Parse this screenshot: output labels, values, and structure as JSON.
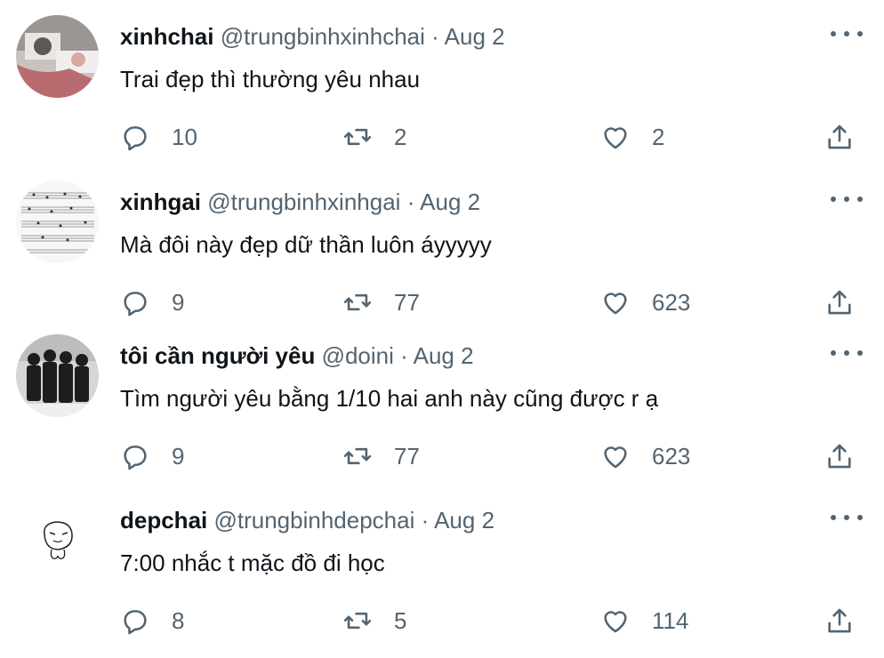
{
  "tweets": [
    {
      "name": "xinhchai",
      "handle": "@trungbinhxinhchai",
      "dot": "·",
      "date": "Aug 2",
      "text": "Trai đẹp thì thường yêu nhau",
      "replies": "10",
      "retweets": "2",
      "likes": "2",
      "avatar_icon": "photo-avatar"
    },
    {
      "name": "xinhgai",
      "handle": "@trungbinhxinhgai",
      "dot": "·",
      "date": "Aug 2",
      "text": "Mà đôi này đẹp dữ thần luôn áyyyyy",
      "replies": "9",
      "retweets": "77",
      "likes": "623",
      "avatar_icon": "sheet-music-avatar"
    },
    {
      "name": "tôi cần người yêu",
      "handle": "@doini",
      "dot": "·",
      "date": "Aug 2",
      "text": "Tìm người yêu bằng 1/10 hai anh này cũng được r ạ",
      "replies": "9",
      "retweets": "77",
      "likes": "623",
      "avatar_icon": "group-photo-avatar"
    },
    {
      "name": "depchai",
      "handle": "@trungbinhdepchai",
      "dot": "·",
      "date": "Aug 2",
      "text": "7:00 nhắc t mặc đồ đi học",
      "replies": "8",
      "retweets": "5",
      "likes": "114",
      "avatar_icon": "doodle-face-avatar"
    }
  ],
  "icons": {
    "reply": "speech-bubble-icon",
    "retweet": "retweet-arrows-icon",
    "like": "heart-icon",
    "share": "share-upload-icon",
    "more": "more-dots-icon"
  },
  "colors": {
    "text": "#0f1419",
    "secondary": "#536471",
    "background": "#ffffff"
  }
}
